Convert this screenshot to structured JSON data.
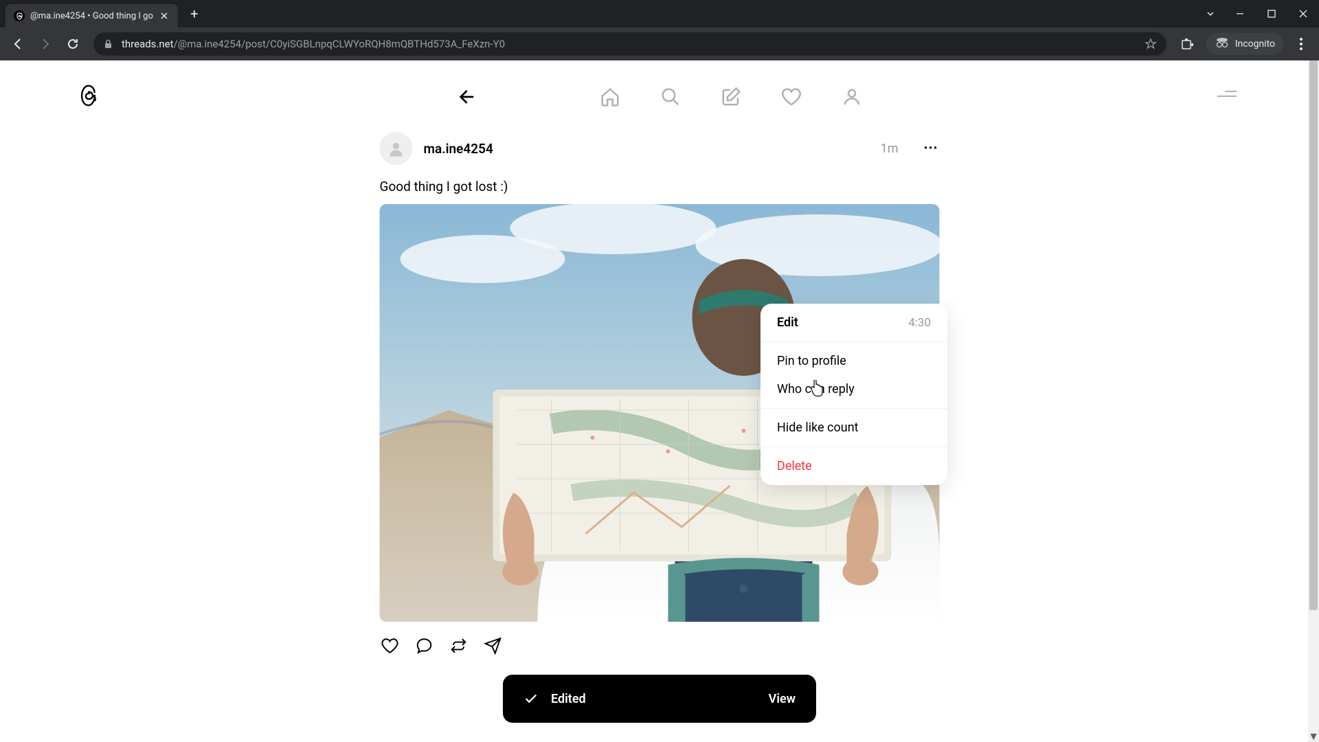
{
  "browser": {
    "tab_title": "@ma.ine4254 • Good thing I go",
    "url_domain": "threads.net",
    "url_path": "/@ma.ine4254/post/C0yiSGBLnpqCLWYoRQH8mQBTHd573A_FeXzn-Y0",
    "incognito_label": "Incognito"
  },
  "post": {
    "username": "ma.ine4254",
    "timestamp": "1m",
    "text": "Good thing I got lost :)"
  },
  "dropdown": {
    "edit": "Edit",
    "edit_time": "4:30",
    "pin": "Pin to profile",
    "who": "Who can reply",
    "hide": "Hide like count",
    "delete": "Delete"
  },
  "toast": {
    "message": "Edited",
    "action": "View"
  }
}
